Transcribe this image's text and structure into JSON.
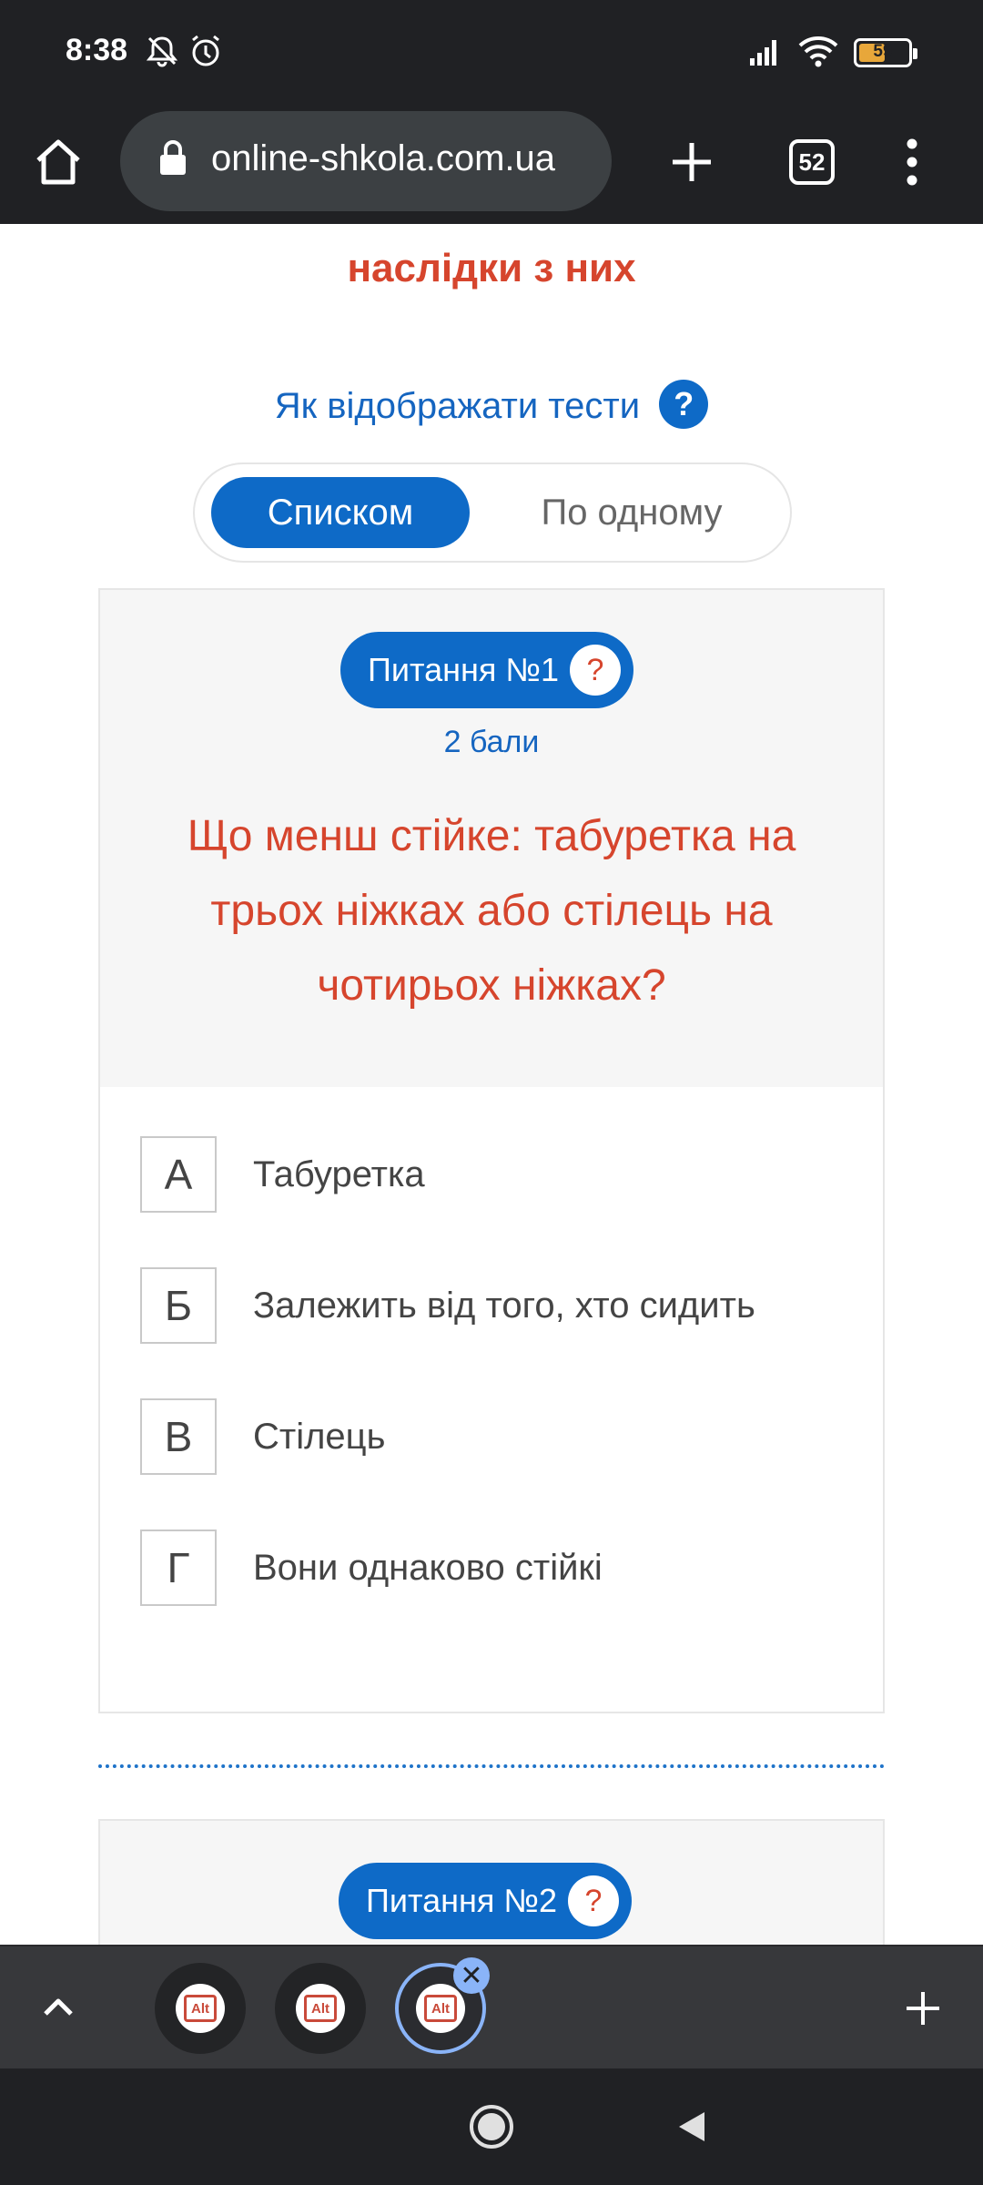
{
  "status_bar": {
    "time": "8:38",
    "battery": 59,
    "icons": [
      "bell-off-icon",
      "alarm-icon",
      "signal-icon",
      "wifi-icon",
      "battery-icon"
    ]
  },
  "browser": {
    "url": "online-shkola.com.ua",
    "tab_count": "52"
  },
  "page": {
    "top_heading": "наслідки з них",
    "display_label": "Як відображати тести",
    "help_symbol": "?",
    "toggle": {
      "active": "Списком",
      "inactive": "По одному"
    }
  },
  "question1": {
    "badge": "Питання №1",
    "help_symbol": "?",
    "points": "2 бали",
    "text": "Що менш стійке: табуретка на трьох ніжках або стілець на чотирьох ніжках?",
    "answers": [
      {
        "letter": "А",
        "text": "Табуретка"
      },
      {
        "letter": "Б",
        "text": "Залежить від того, хто сидить"
      },
      {
        "letter": "В",
        "text": "Стілець"
      },
      {
        "letter": "Г",
        "text": "Вони однаково стійкі"
      }
    ]
  },
  "question2": {
    "badge": "Питання №2",
    "help_symbol": "?"
  },
  "tab_strip": {
    "favicon_label": "Alt",
    "close_symbol": "✕"
  },
  "colors": {
    "accent_blue": "#0e6ac7",
    "question_red": "#d6452d",
    "chrome_dark": "#202124"
  }
}
